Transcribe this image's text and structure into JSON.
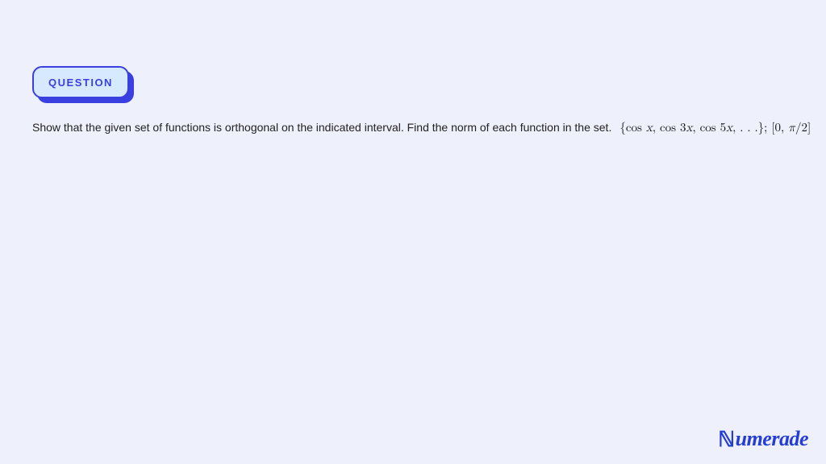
{
  "badge": {
    "label": "QUESTION"
  },
  "question": {
    "text": "Show that the given set of functions is orthogonal on the indicated interval. Find the norm of each function in the set.",
    "math": "{cos x, cos 3x, cos 5x, . . .}; [0, π/2]"
  },
  "brand": {
    "name": "Numerade"
  }
}
